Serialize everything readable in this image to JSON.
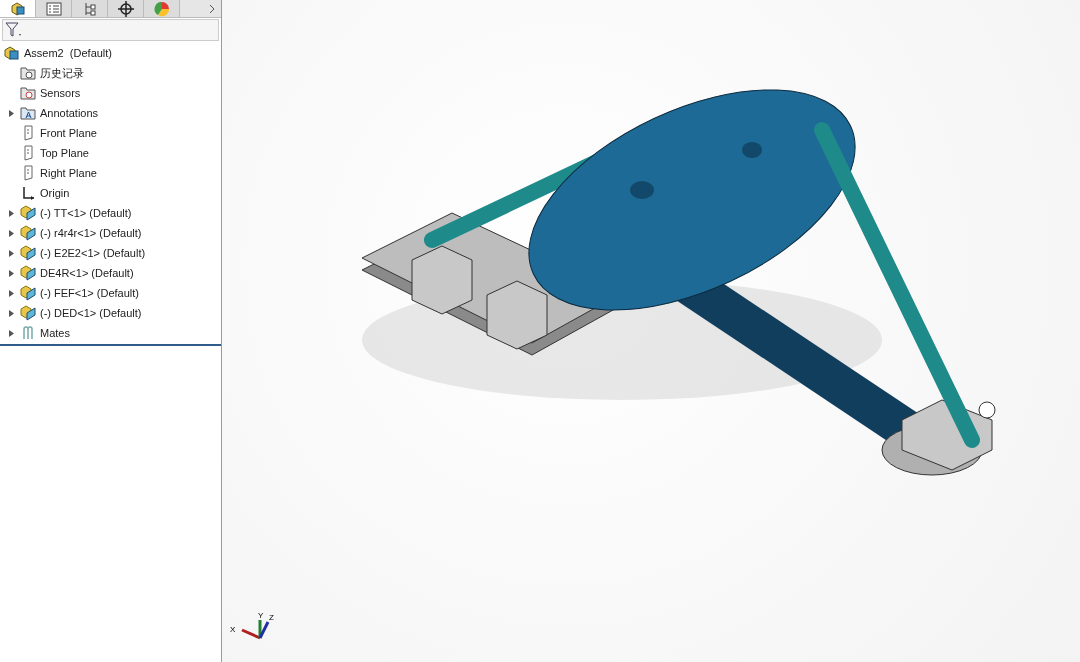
{
  "panel_tabs": [
    {
      "kind": "feature",
      "selected": true
    },
    {
      "kind": "property",
      "selected": false
    },
    {
      "kind": "config",
      "selected": false
    },
    {
      "kind": "dim",
      "selected": false
    },
    {
      "kind": "display",
      "selected": false
    }
  ],
  "tree": {
    "label": "Assem2  (Default)",
    "kind": "assembly",
    "children": [
      {
        "label": "历史记录",
        "kind": "history",
        "expandable": false
      },
      {
        "label": "Sensors",
        "kind": "sensor",
        "expandable": false
      },
      {
        "label": "Annotations",
        "kind": "annotation",
        "expandable": true
      },
      {
        "label": "Front Plane",
        "kind": "plane",
        "expandable": false
      },
      {
        "label": "Top Plane",
        "kind": "plane",
        "expandable": false
      },
      {
        "label": "Right Plane",
        "kind": "plane",
        "expandable": false
      },
      {
        "label": "Origin",
        "kind": "origin",
        "expandable": false
      },
      {
        "label": "(-) TT<1> (Default)",
        "kind": "part",
        "expandable": true
      },
      {
        "label": "(-) r4r4r<1> (Default)",
        "kind": "part",
        "expandable": true
      },
      {
        "label": "(-) E2E2<1> (Default)",
        "kind": "part",
        "expandable": true
      },
      {
        "label": "DE4R<1> (Default)",
        "kind": "part",
        "expandable": true
      },
      {
        "label": "(-) FEF<1> (Default)",
        "kind": "part",
        "expandable": true
      },
      {
        "label": "(-) DED<1> (Default)",
        "kind": "part",
        "expandable": true
      },
      {
        "label": "Mates",
        "kind": "mates",
        "expandable": true
      }
    ]
  },
  "triad": {
    "x": "X",
    "y": "Y",
    "z": "Z"
  }
}
